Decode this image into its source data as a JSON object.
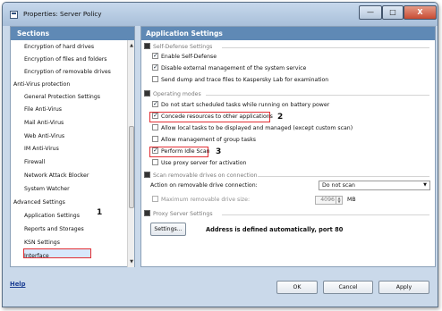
{
  "window": {
    "title": "Properties: Server Policy",
    "controls": {
      "minimize": "—",
      "maximize": "□",
      "close": "X"
    }
  },
  "sections": {
    "header": "Sections",
    "items": [
      {
        "label": "Encryption of hard drives",
        "level": 1
      },
      {
        "label": "Encryption of files and folders",
        "level": 1
      },
      {
        "label": "Encryption of removable drives",
        "level": 1
      },
      {
        "label": "Anti-Virus protection",
        "level": 0
      },
      {
        "label": "General Protection Settings",
        "level": 1
      },
      {
        "label": "File Anti-Virus",
        "level": 1
      },
      {
        "label": "Mail Anti-Virus",
        "level": 1
      },
      {
        "label": "Web Anti-Virus",
        "level": 1
      },
      {
        "label": "IM Anti-Virus",
        "level": 1
      },
      {
        "label": "Firewall",
        "level": 1
      },
      {
        "label": "Network Attack Blocker",
        "level": 1
      },
      {
        "label": "System Watcher",
        "level": 1
      },
      {
        "label": "Advanced Settings",
        "level": 0
      },
      {
        "label": "Application Settings",
        "level": 1,
        "selected": true
      },
      {
        "label": "Reports and Storages",
        "level": 1
      },
      {
        "label": "KSN Settings",
        "level": 1
      },
      {
        "label": "Interface",
        "level": 1
      }
    ],
    "annotation": "1"
  },
  "settings": {
    "header": "Application Settings",
    "self_defense": {
      "title": "Self-Defense Settings",
      "options": [
        {
          "label": "Enable Self-Defense",
          "checked": true
        },
        {
          "label": "Disable external management of the system service",
          "checked": true
        },
        {
          "label": "Send dump and trace files to Kaspersky Lab for examination",
          "checked": false
        }
      ]
    },
    "operating": {
      "title": "Operating modes",
      "options": [
        {
          "label": "Do not start scheduled tasks while running on battery power",
          "checked": true
        },
        {
          "label": "Concede resources to other applications",
          "checked": true,
          "annotation": "2"
        },
        {
          "label": "Allow local tasks to be displayed and managed (except custom scan)",
          "checked": false
        },
        {
          "label": "Allow management of group tasks",
          "checked": false
        },
        {
          "label": "Perform Idle Scan",
          "checked": true,
          "annotation": "3"
        },
        {
          "label": "Use proxy server for activation",
          "checked": false
        }
      ]
    },
    "removable": {
      "title": "Scan removable drives on connection",
      "action_label": "Action on removable drive connection:",
      "action_value": "Do not scan",
      "max_size_label": "Maximum removable drive size:",
      "max_size_value": "4096",
      "unit": "MB"
    },
    "proxy": {
      "title": "Proxy Server Settings",
      "button": "Settings...",
      "status": "Address is defined automatically, port 80"
    }
  },
  "footer": {
    "help": "Help",
    "ok": "OK",
    "cancel": "Cancel",
    "apply": "Apply"
  },
  "colors": {
    "header": "#5f89b5",
    "highlight": "#e22f34"
  }
}
